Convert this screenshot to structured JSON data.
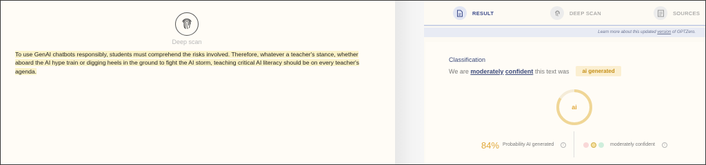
{
  "editor": {
    "deep_scan_label": "Deep scan",
    "icon": "fingerprint-icon",
    "essay_text": "To use GenAI chatbots responsibly, students must comprehend the risks involved. Therefore, whatever a teacher's stance, whether aboard the AI hype train or digging heels in the ground to fight the AI storm, teaching critical AI literacy should be on every teacher's agenda.",
    "highlight_color": "#fbf2c7"
  },
  "tabs": [
    {
      "label": "RESULT",
      "icon": "document-icon",
      "active": true
    },
    {
      "label": "DEEP SCAN",
      "icon": "fingerprint-icon",
      "active": false
    },
    {
      "label": "SOURCES",
      "icon": "sources-icon",
      "active": false
    }
  ],
  "info_strip": {
    "prefix": "Learn more about this updated",
    "link": "version",
    "suffix": "of GPTZero."
  },
  "classification": {
    "title": "Classification",
    "sentence_start": "We are",
    "confidence_word": "moderately",
    "confident_word": "confident",
    "sentence_end": "this text was",
    "badge": "ai generated"
  },
  "donut": {
    "center_label": "ai",
    "ai_fraction": 0.84,
    "ai_color": "#f0d696",
    "rest_color": "#f5ecd8"
  },
  "probability": {
    "percent": "84%",
    "label": "Probability AI generated"
  },
  "confidence": {
    "label": "moderately confident",
    "dots": [
      {
        "name": "low",
        "color": "#f9d8d8"
      },
      {
        "name": "moderate",
        "color": "#f4dfa0"
      },
      {
        "name": "high",
        "color": "#cfeedc"
      }
    ]
  },
  "colors": {
    "accent": "#3c4a7a",
    "ai_orange": "#e1a93c"
  }
}
